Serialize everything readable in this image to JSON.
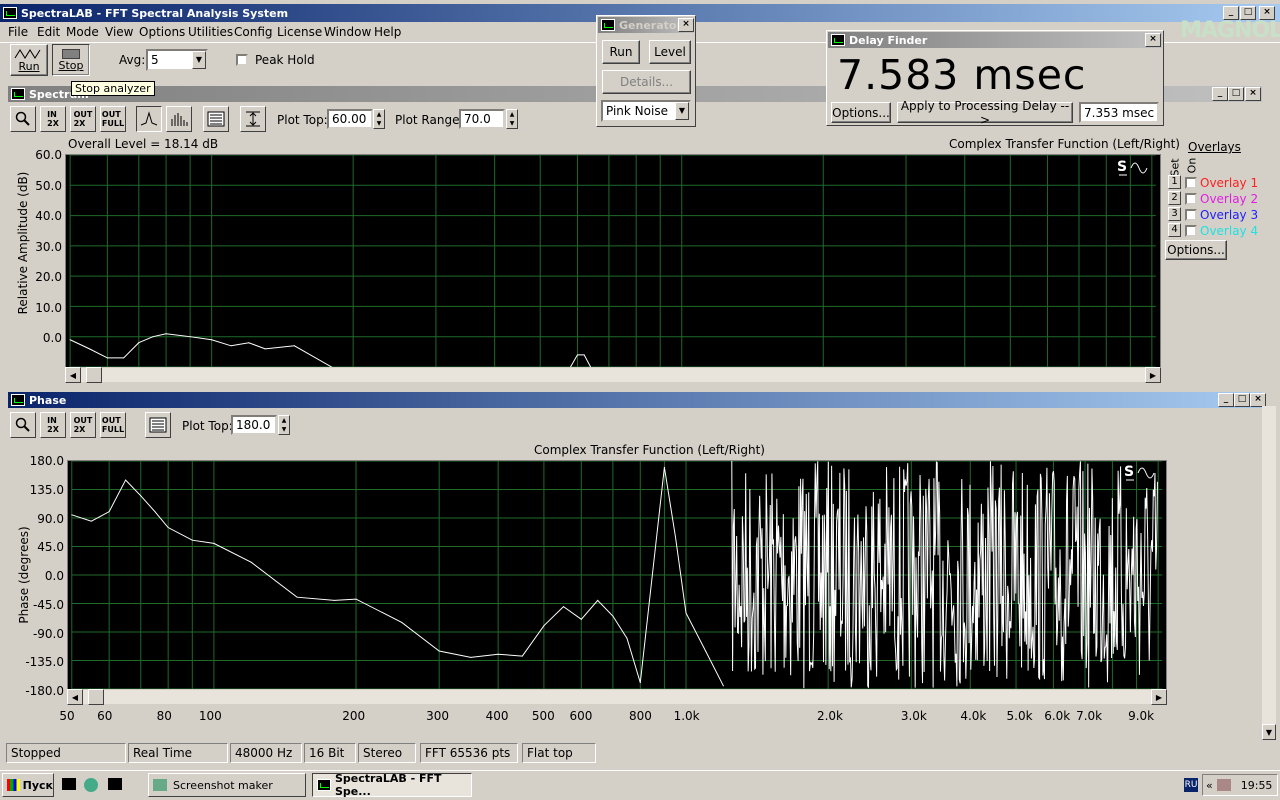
{
  "app": {
    "title": "SpectraLAB - FFT Spectral Analysis System"
  },
  "menu": [
    "File",
    "Edit",
    "Mode",
    "View",
    "Options",
    "Utilities",
    "Config",
    "License",
    "Window",
    "Help"
  ],
  "toolbar": {
    "run_label": "Run",
    "stop_label": "Stop",
    "avg_label": "Avg:",
    "avg_value": "5",
    "peak_hold_label": "Peak Hold",
    "tooltip": "Stop analyzer"
  },
  "generator": {
    "title": "Generator",
    "run_label": "Run",
    "level_label": "Level",
    "details_label": "Details...",
    "noise_value": "Pink Noise"
  },
  "delay_finder": {
    "title": "Delay Finder",
    "value": "7.583 msec",
    "options_label": "Options...",
    "apply_label": "Apply to Processing Delay -->",
    "delay_value": "7.353 msec"
  },
  "logo": {
    "text": "MAGNOLIA"
  },
  "spectrum": {
    "title": "Spectrum",
    "plot_top_label": "Plot Top:",
    "plot_top_value": "60.00",
    "plot_range_label": "Plot Range:",
    "plot_range_value": "70.0",
    "overall_level": "Overall Level = 18.14 dB",
    "function_label": "Complex Transfer Function (Left/Right)",
    "ylabel": "Relative Amplitude (dB)",
    "yticks": [
      "60.0",
      "50.0",
      "40.0",
      "30.0",
      "20.0",
      "10.0",
      "0.0"
    ],
    "overlays_label": "Overlays",
    "set_label": "Set",
    "on_label": "On",
    "overlays": [
      {
        "num": "1",
        "name": "Overlay 1",
        "color": "#ff2020"
      },
      {
        "num": "2",
        "name": "Overlay 2",
        "color": "#e020e0"
      },
      {
        "num": "3",
        "name": "Overlay 3",
        "color": "#2020ff"
      },
      {
        "num": "4",
        "name": "Overlay 4",
        "color": "#20e0e0"
      }
    ],
    "options_label": "Options..."
  },
  "phase": {
    "title": "Phase",
    "plot_top_label": "Plot Top:",
    "plot_top_value": "180.0",
    "function_label": "Complex Transfer Function (Left/Right)",
    "ylabel": "Phase (degrees)",
    "yticks": [
      "180.0",
      "135.0",
      "90.0",
      "45.0",
      "0.0",
      "-45.0",
      "-90.0",
      "-135.0",
      "-180.0"
    ]
  },
  "xaxis": {
    "ticks": [
      "50",
      "60",
      "80",
      "100",
      "200",
      "300",
      "400",
      "500",
      "600",
      "800",
      "1.0k",
      "2.0k",
      "3.0k",
      "4.0k",
      "5.0k",
      "6.0k",
      "7.0k",
      "9.0k"
    ]
  },
  "status": [
    "Stopped",
    "Real Time",
    "48000 Hz",
    "16 Bit",
    "Stereo",
    "FFT 65536 pts",
    "Flat top"
  ],
  "taskbar": {
    "start_label": "Пуск",
    "task1": "Screenshot maker",
    "task2": "SpectraLAB - FFT Spe...",
    "lang": "RU",
    "clock": "19:55"
  },
  "chart_data": [
    {
      "type": "line",
      "title": "Complex Transfer Function (Left/Right)",
      "ylabel": "Relative Amplitude (dB)",
      "xscale": "log",
      "ylim": [
        -10,
        60
      ],
      "grid": true,
      "series": [
        {
          "x": [
            50,
            55,
            60,
            65,
            70,
            75,
            80,
            90,
            100,
            110,
            120,
            130,
            150,
            180
          ],
          "y": [
            -1,
            -4,
            -7,
            -7,
            -2,
            0,
            1,
            0,
            -1,
            -3,
            -2,
            -4,
            -3,
            -10
          ]
        },
        {
          "x": [
            580,
            600,
            620,
            640
          ],
          "y": [
            -10,
            -6,
            -6,
            -10
          ]
        }
      ]
    },
    {
      "type": "line",
      "title": "Complex Transfer Function (Left/Right)",
      "ylabel": "Phase (degrees)",
      "xscale": "log",
      "ylim": [
        -180,
        180
      ],
      "grid": true,
      "series": [
        {
          "x": [
            50,
            55,
            60,
            65,
            70,
            75,
            80,
            90,
            100,
            120,
            150,
            180,
            200,
            250,
            300,
            350,
            400,
            450,
            500,
            550,
            600,
            650,
            700,
            750,
            800,
            900,
            950,
            1000,
            1100,
            1200
          ],
          "y": [
            95,
            85,
            100,
            150,
            125,
            100,
            75,
            55,
            50,
            20,
            -35,
            -40,
            -38,
            -75,
            -120,
            -130,
            -125,
            -128,
            -80,
            -50,
            -70,
            -40,
            -65,
            -100,
            -170,
            170,
            60,
            -60,
            -120,
            -175
          ]
        }
      ]
    }
  ]
}
